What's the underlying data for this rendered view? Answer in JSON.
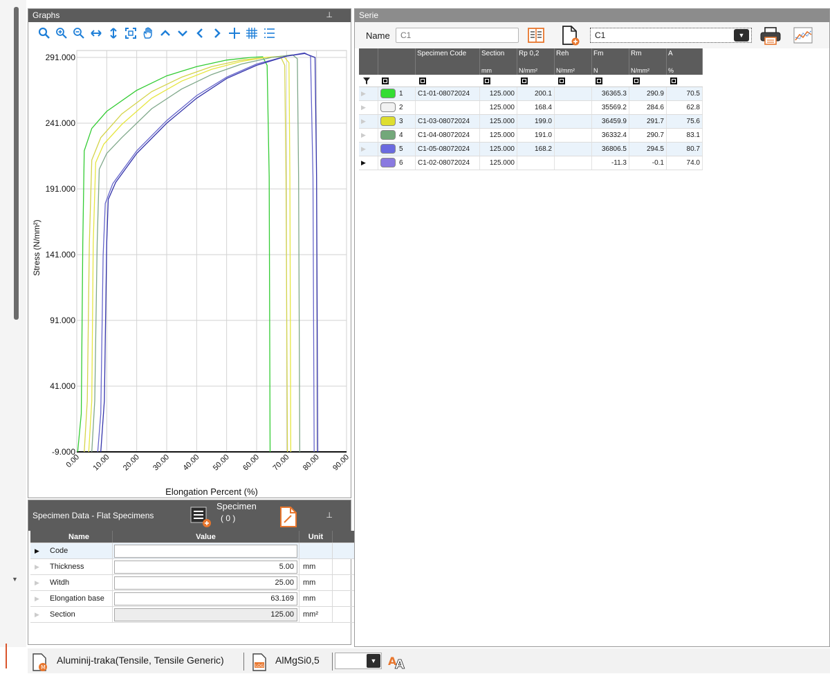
{
  "graphs_panel": {
    "title": "Graphs",
    "pin_icon": "pin-icon",
    "toolbar": [
      "search-icon",
      "zoom-in-icon",
      "zoom-out-icon",
      "stretch-horizontal-icon",
      "stretch-vertical-icon",
      "fit-icon",
      "pan-hand-icon",
      "chevron-up-icon",
      "chevron-down-icon",
      "chevron-left-icon",
      "chevron-right-icon",
      "crosshair-icon",
      "grid-icon",
      "legend-list-icon"
    ]
  },
  "chart_data": {
    "type": "line",
    "xlabel": "Elongation Percent (%)",
    "ylabel": "Stress (N/mm²)",
    "xlim": [
      0,
      90
    ],
    "ylim": [
      -9,
      300
    ],
    "x_ticks": [
      "0.00",
      "10.00",
      "20.00",
      "30.00",
      "40.00",
      "50.00",
      "60.00",
      "70.00",
      "80.00",
      "90.00"
    ],
    "y_ticks": [
      "-9.000",
      "41.000",
      "91.000",
      "141.000",
      "191.000",
      "241.000",
      "291.000"
    ],
    "y_tick_values": [
      -9,
      41,
      91,
      141,
      191,
      241,
      291
    ],
    "series": [
      {
        "color": "#33cc33",
        "points": [
          [
            0.3,
            -9
          ],
          [
            1.5,
            20
          ],
          [
            2,
            150
          ],
          [
            2.5,
            220
          ],
          [
            5,
            237
          ],
          [
            10,
            250
          ],
          [
            20,
            266
          ],
          [
            30,
            277
          ],
          [
            40,
            284
          ],
          [
            50,
            289
          ],
          [
            58,
            291
          ],
          [
            62,
            291.5
          ],
          [
            63.5,
            285
          ],
          [
            64.2,
            200
          ],
          [
            64.5,
            -9
          ]
        ]
      },
      {
        "color": "#d4d44a",
        "points": [
          [
            2.5,
            -9
          ],
          [
            3.5,
            30
          ],
          [
            4.2,
            150
          ],
          [
            5,
            213
          ],
          [
            8,
            230
          ],
          [
            15,
            248
          ],
          [
            25,
            265
          ],
          [
            35,
            276
          ],
          [
            45,
            284
          ],
          [
            55,
            289
          ],
          [
            63,
            291
          ],
          [
            68,
            291.5
          ],
          [
            69.4,
            285
          ],
          [
            69.8,
            200
          ],
          [
            70.3,
            -9
          ]
        ]
      },
      {
        "color": "#e6e640",
        "points": [
          [
            4,
            -9
          ],
          [
            5,
            30
          ],
          [
            5.5,
            150
          ],
          [
            6.3,
            211
          ],
          [
            9,
            225
          ],
          [
            15,
            240
          ],
          [
            25,
            260
          ],
          [
            35,
            273
          ],
          [
            45,
            282
          ],
          [
            55,
            288
          ],
          [
            63,
            291
          ],
          [
            69,
            292
          ],
          [
            70.8,
            287
          ],
          [
            71.1,
            200
          ],
          [
            71.4,
            -9
          ]
        ]
      },
      {
        "color": "#7fa88a",
        "points": [
          [
            5,
            -9
          ],
          [
            6,
            30
          ],
          [
            6.8,
            150
          ],
          [
            7.5,
            206
          ],
          [
            10,
            218
          ],
          [
            15,
            230
          ],
          [
            25,
            252
          ],
          [
            35,
            267
          ],
          [
            45,
            278
          ],
          [
            55,
            286
          ],
          [
            65,
            291
          ],
          [
            72,
            293
          ],
          [
            73.6,
            290
          ],
          [
            74,
            200
          ],
          [
            74.4,
            -9
          ]
        ]
      },
      {
        "color": "#6666cc",
        "points": [
          [
            7,
            -9
          ],
          [
            8,
            20
          ],
          [
            8.8,
            140
          ],
          [
            9.5,
            180
          ],
          [
            12,
            195
          ],
          [
            20,
            220
          ],
          [
            30,
            243
          ],
          [
            40,
            262
          ],
          [
            50,
            276
          ],
          [
            60,
            286
          ],
          [
            70,
            292
          ],
          [
            76,
            294.5
          ],
          [
            78,
            292
          ],
          [
            78.8,
            200
          ],
          [
            79.2,
            -9
          ]
        ]
      },
      {
        "color": "#3333aa",
        "points": [
          [
            8,
            -9
          ],
          [
            9.2,
            30
          ],
          [
            10,
            150
          ],
          [
            10.5,
            183
          ],
          [
            13,
            196
          ],
          [
            20,
            218
          ],
          [
            30,
            241
          ],
          [
            40,
            260
          ],
          [
            50,
            275
          ],
          [
            60,
            285
          ],
          [
            70,
            292
          ],
          [
            76,
            294
          ],
          [
            79.5,
            291
          ],
          [
            80,
            200
          ],
          [
            80.4,
            -9
          ]
        ]
      }
    ]
  },
  "specimen_panel": {
    "title": "Specimen Data - Flat Specimens",
    "specimen_button_label": "Specimen",
    "specimen_count": "( 0 )",
    "columns": {
      "name": "Name",
      "value": "Value",
      "unit": "Unit"
    },
    "rows": [
      {
        "name": "Code",
        "value": "",
        "unit": "",
        "readonly": false
      },
      {
        "name": "Thickness",
        "value": "5.00",
        "unit": "mm",
        "readonly": false
      },
      {
        "name": "Witdh",
        "value": "25.00",
        "unit": "mm",
        "readonly": false
      },
      {
        "name": "Elongation base",
        "value": "63.169",
        "unit": "mm",
        "readonly": false
      },
      {
        "name": "Section",
        "value": "125.00",
        "unit": "mm²",
        "readonly": true
      }
    ]
  },
  "serie_panel": {
    "title": "Serie",
    "name_label": "Name",
    "name_placeholder": "C1",
    "selected_serie": "C1",
    "columns": [
      {
        "label": "",
        "unit": ""
      },
      {
        "label": "Specimen Code",
        "unit": ""
      },
      {
        "label": "Section",
        "unit": "mm"
      },
      {
        "label": "Rp 0,2",
        "unit": "N/mm²"
      },
      {
        "label": "Reh",
        "unit": "N/mm²"
      },
      {
        "label": "Fm",
        "unit": "N"
      },
      {
        "label": "Rm",
        "unit": "N/mm²"
      },
      {
        "label": "A",
        "unit": "%"
      }
    ],
    "rows": [
      {
        "index": "1",
        "color": "#33dd33",
        "code": "C1-01-08072024",
        "section": "125.000",
        "rp02": "200.1",
        "reh": "",
        "fm": "36365.3",
        "rm": "290.9",
        "a": "70.5",
        "current": false
      },
      {
        "index": "2",
        "color": "#f2f2f2",
        "code": "",
        "section": "125.000",
        "rp02": "168.4",
        "reh": "",
        "fm": "35569.2",
        "rm": "284.6",
        "a": "62.8",
        "current": false
      },
      {
        "index": "3",
        "color": "#dede30",
        "code": "C1-03-08072024",
        "section": "125.000",
        "rp02": "199.0",
        "reh": "",
        "fm": "36459.9",
        "rm": "291.7",
        "a": "75.6",
        "current": false
      },
      {
        "index": "4",
        "color": "#73a87a",
        "code": "C1-04-08072024",
        "section": "125.000",
        "rp02": "191.0",
        "reh": "",
        "fm": "36332.4",
        "rm": "290.7",
        "a": "83.1",
        "current": false
      },
      {
        "index": "5",
        "color": "#6a6ae0",
        "code": "C1-05-08072024",
        "section": "125.000",
        "rp02": "168.2",
        "reh": "",
        "fm": "36806.5",
        "rm": "294.5",
        "a": "80.7",
        "current": false
      },
      {
        "index": "6",
        "color": "#8a7ae0",
        "code": "C1-02-08072024",
        "section": "125.000",
        "rp02": "",
        "reh": "",
        "fm": "-11.3",
        "rm": "-0.1",
        "a": "74.0",
        "current": true
      }
    ]
  },
  "status_bar": {
    "method_label": "Aluminij-traka(Tensile, Tensile Generic)",
    "material_label": "AlMgSi0,5"
  },
  "colors": {
    "accent": "#1e7fd8",
    "orange_icon": "#e8762d",
    "header": "#5c5c5c"
  }
}
